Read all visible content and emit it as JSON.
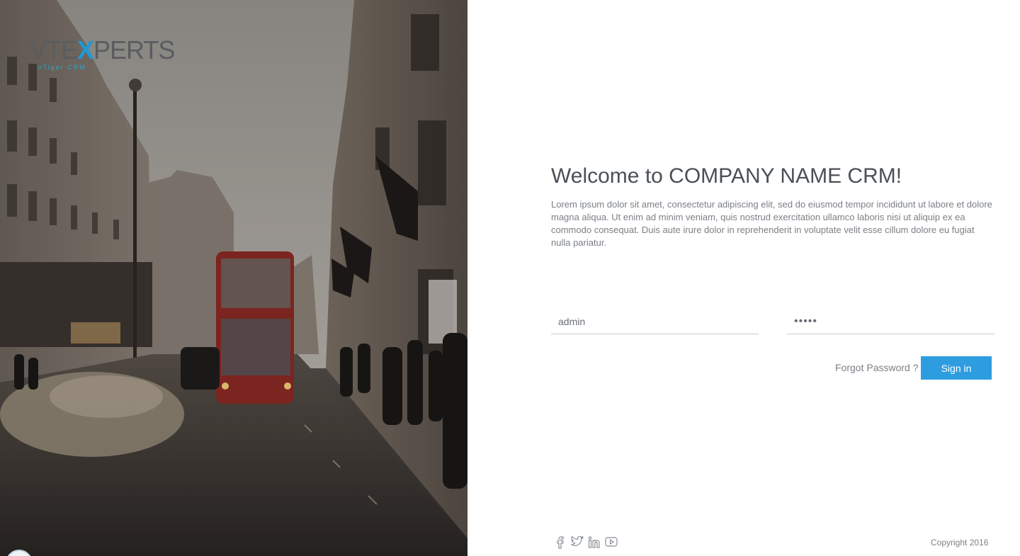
{
  "brand": {
    "logo_prefix": "VTE",
    "logo_x": "X",
    "logo_suffix": "PERTS",
    "logo_tagline": "vTiger CRM"
  },
  "login": {
    "title": "Welcome to COMPANY NAME CRM!",
    "description": "Lorem ipsum dolor sit amet, consectetur adipiscing elit, sed do eiusmod tempor incididunt ut labore et dolore magna aliqua. Ut enim ad minim veniam, quis nostrud exercitation ullamco laboris nisi ut aliquip ex ea commodo consequat. Duis aute irure dolor in reprehenderit in voluptate velit esse cillum dolore eu fugiat nulla pariatur.",
    "username_value": "admin",
    "password_value": "admin",
    "forgot_label": "Forgot Password ?",
    "signin_label": "Sign in"
  },
  "footer": {
    "social_icons": [
      "facebook-icon",
      "twitter-icon",
      "linkedin-icon",
      "youtube-icon"
    ],
    "copyright": "Copyright 2016"
  },
  "colors": {
    "accent": "#2e9de0",
    "title": "#4a5056",
    "body_text": "#7b7f85"
  }
}
